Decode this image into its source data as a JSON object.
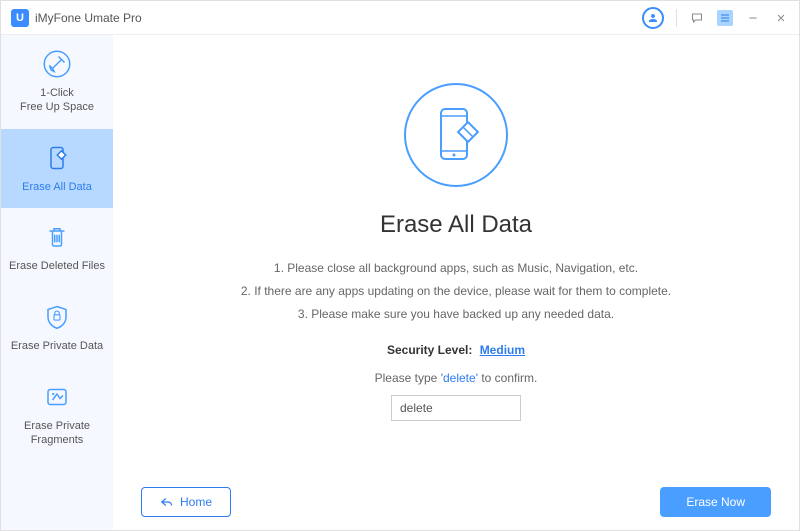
{
  "app": {
    "logo_letter": "U",
    "title": "iMyFone Umate Pro"
  },
  "sidebar": {
    "items": [
      {
        "label": "1-Click\nFree Up Space"
      },
      {
        "label": "Erase All Data"
      },
      {
        "label": "Erase Deleted Files"
      },
      {
        "label": "Erase Private Data"
      },
      {
        "label": "Erase Private\nFragments"
      }
    ]
  },
  "main": {
    "heading": "Erase All Data",
    "instructions": [
      "1. Please close all background apps, such as Music, Navigation, etc.",
      "2. If there are any apps updating on the device, please wait for them to complete.",
      "3. Please make sure you have backed up any needed data."
    ],
    "security_label": "Security Level:",
    "security_value": "Medium",
    "confirm_prefix": "Please type",
    "confirm_keyword": "'delete'",
    "confirm_suffix": "to confirm.",
    "confirm_input_value": "delete"
  },
  "footer": {
    "home_label": "Home",
    "erase_label": "Erase Now"
  }
}
